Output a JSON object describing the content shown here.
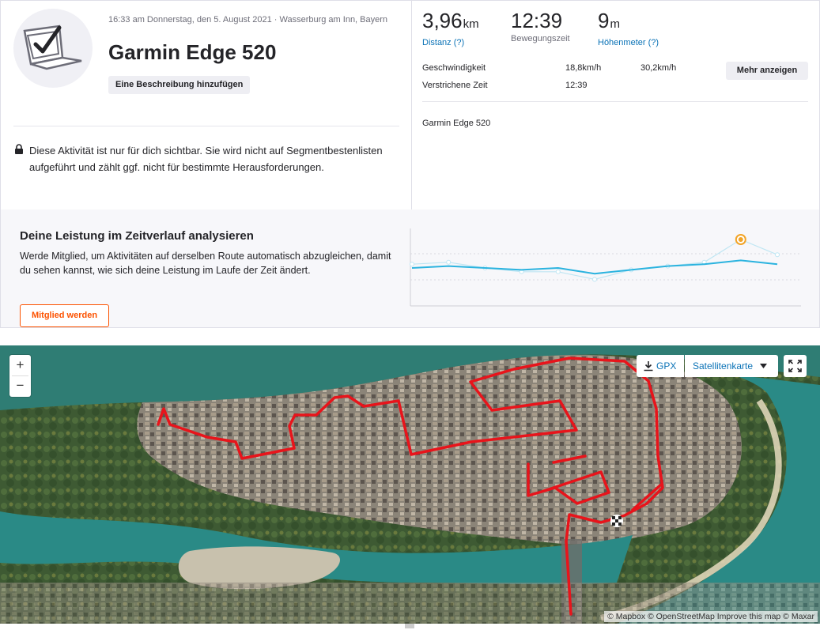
{
  "activity": {
    "datetime": "16:33 am Donnerstag, den 5. August 2021 · Wasserburg am Inn, Bayern",
    "title": "Garmin Edge 520",
    "add_description_label": "Eine Beschreibung hinzufügen",
    "privacy_text": "Diese Aktivität ist nur für dich sichtbar. Sie wird nicht auf Segmentbestenlisten aufgeführt und zählt ggf. nicht für bestimmte Herausforderungen."
  },
  "stats": {
    "distance": {
      "value": "3,96",
      "unit": "km",
      "label": "Distanz (?)"
    },
    "moving_time": {
      "value": "12:39",
      "label": "Bewegungszeit"
    },
    "elevation": {
      "value": "9",
      "unit": "m",
      "label": "Höhenmeter (?)"
    }
  },
  "details": {
    "speed_label": "Geschwindigkeit",
    "speed_avg": "18,8km/h",
    "speed_max": "30,2km/h",
    "elapsed_label": "Verstrichene Zeit",
    "elapsed_value": "12:39",
    "more_label": "Mehr anzeigen",
    "device": "Garmin Edge 520"
  },
  "performance": {
    "title": "Deine Leistung im Zeitverlauf analysieren",
    "text": "Werde Mitglied, um Aktivitäten auf derselben Route automatisch abzugleichen, damit du sehen kannst, wie sich deine Leistung im Laufe der Zeit ändert.",
    "cta_label": "Mitglied werden"
  },
  "chart_data": {
    "type": "line",
    "x": [
      1,
      2,
      3,
      4,
      5,
      6,
      7,
      8,
      9,
      10,
      11
    ],
    "series": [
      {
        "values": [
          62,
          63,
          60,
          58,
          58,
          54,
          59,
          61,
          63,
          75,
          67
        ]
      },
      {
        "values": [
          60,
          61,
          60,
          59,
          60,
          57,
          59,
          61,
          62,
          64,
          62
        ]
      }
    ],
    "ylim": [
      40,
      80
    ],
    "highlight_index": 9,
    "colors": {
      "series_main": "#2bb3df",
      "series_faint": "#bfe6f3",
      "highlight": "#f2a427"
    }
  },
  "map": {
    "zoom_in": "+",
    "zoom_out": "−",
    "gpx_label": "GPX",
    "layer_label": "Satellitenkarte",
    "attribution": "© Mapbox © OpenStreetMap Improve this map © Maxar",
    "route_color": "#e8141b"
  },
  "icons": {
    "avatar": "checkmark-device-icon",
    "lock": "lock-icon",
    "download": "download-icon",
    "caret": "caret-down-icon",
    "fullscreen": "fullscreen-icon",
    "finish": "checkered-flag-icon"
  }
}
